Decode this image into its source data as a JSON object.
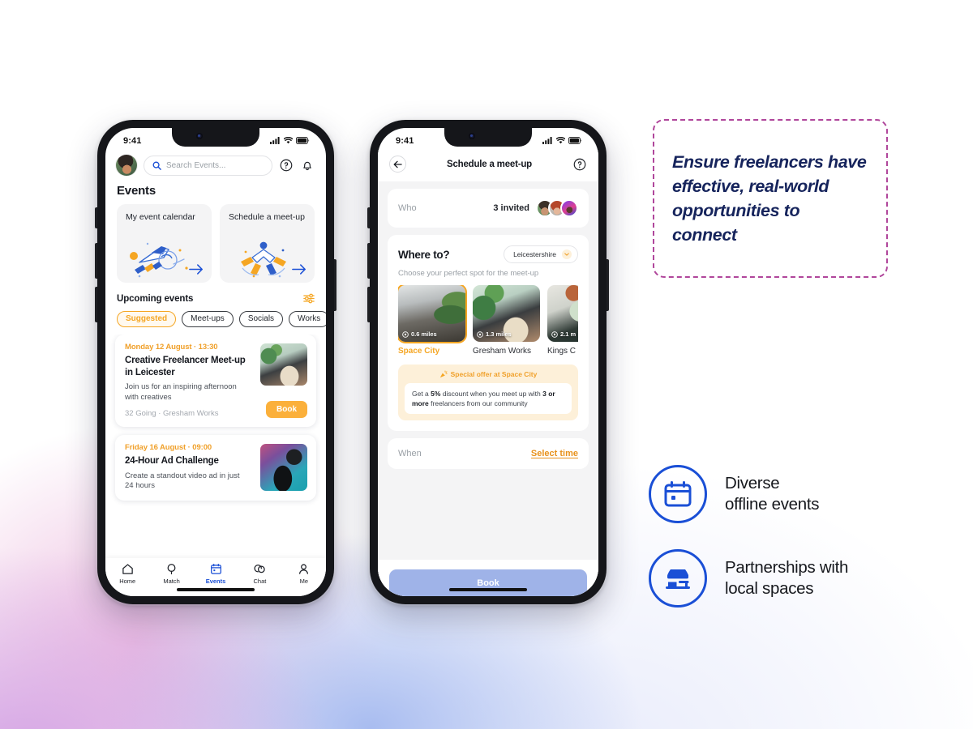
{
  "phone1": {
    "status": {
      "time": "9:41",
      "signal_icon": "cellular-signal-icon",
      "wifi_icon": "wifi-icon",
      "battery_icon": "battery-icon"
    },
    "topbar": {
      "avatar": "user-avatar",
      "search_placeholder": "Search Events...",
      "search_icon": "search-icon",
      "help_icon": "help-circle-icon",
      "bell_icon": "notification-bell-icon"
    },
    "page_title": "Events",
    "quick_cards": [
      {
        "title": "My event calendar",
        "illustration": "rocket-illustration",
        "arrow": "arrow-right-icon"
      },
      {
        "title": "Schedule a meet-up",
        "illustration": "people-illustration",
        "arrow": "arrow-right-icon"
      }
    ],
    "upcoming": {
      "label": "Upcoming events",
      "filter_icon": "filter-sliders-icon"
    },
    "chips": [
      {
        "label": "Suggested",
        "active": true
      },
      {
        "label": "Meet-ups",
        "active": false
      },
      {
        "label": "Socials",
        "active": false
      },
      {
        "label": "Works",
        "active": false
      }
    ],
    "events": [
      {
        "date": "Monday 12 August · 13:30",
        "title": "Creative Freelancer Meet-up in Leicester",
        "description": "Join us for an inspiring afternoon with creatives",
        "meta": "32 Going · Gresham Works",
        "action": "Book",
        "thumb": "lounge-photo"
      },
      {
        "date": "Friday 16 August · 09:00",
        "title": "24-Hour Ad Challenge",
        "description": "Create a standout video ad in just 24 hours",
        "meta": "",
        "action": "",
        "thumb": "camera-photo"
      }
    ],
    "tabs": [
      {
        "label": "Home",
        "icon": "home-icon",
        "active": false
      },
      {
        "label": "Match",
        "icon": "match-icon",
        "active": false
      },
      {
        "label": "Events",
        "icon": "calendar-icon",
        "active": true
      },
      {
        "label": "Chat",
        "icon": "chat-icon",
        "active": false
      },
      {
        "label": "Me",
        "icon": "person-icon",
        "active": false
      }
    ]
  },
  "phone2": {
    "status": {
      "time": "9:41"
    },
    "nav": {
      "back_icon": "arrow-left-icon",
      "title": "Schedule a meet-up",
      "help_icon": "help-circle-icon"
    },
    "who": {
      "label": "Who",
      "count": "3 invited",
      "avatars": [
        "invitee-1",
        "invitee-2",
        "invitee-3"
      ]
    },
    "where": {
      "title": "Where to?",
      "region": "Leicestershire",
      "chevron_icon": "chevron-down-icon",
      "subtitle": "Choose your perfect spot for the meet-up",
      "venues": [
        {
          "name": "Space City",
          "distance": "0.6 miles",
          "selected": true
        },
        {
          "name": "Gresham Works",
          "distance": "1.3 miles",
          "selected": false
        },
        {
          "name": "Kings C",
          "distance": "2.1 m",
          "selected": false
        }
      ]
    },
    "offer": {
      "icon": "party-popper-icon",
      "heading": "Special offer at Space City",
      "body_pre": "Get a ",
      "body_b1": "5%",
      "body_mid": " discount when you meet up with ",
      "body_b2": "3 or more",
      "body_post": " freelancers from our community"
    },
    "when": {
      "label": "When",
      "action": "Select time"
    },
    "book_label": "Book"
  },
  "callout": {
    "quote": "Ensure freelancers have effective, real-world opportunities to connect",
    "features": [
      {
        "icon": "calendar-outline-icon",
        "line1": "Diverse",
        "line2": "offline events"
      },
      {
        "icon": "storefront-icon",
        "line1": "Partnerships with",
        "line2": "local spaces"
      }
    ]
  },
  "colors": {
    "accent_orange": "#f5a623",
    "brand_blue": "#1a4fd6",
    "quote_border": "#b0469b",
    "quote_text": "#16245c",
    "book_button": "#9fb3e8",
    "book_orange": "#fbb03b"
  }
}
